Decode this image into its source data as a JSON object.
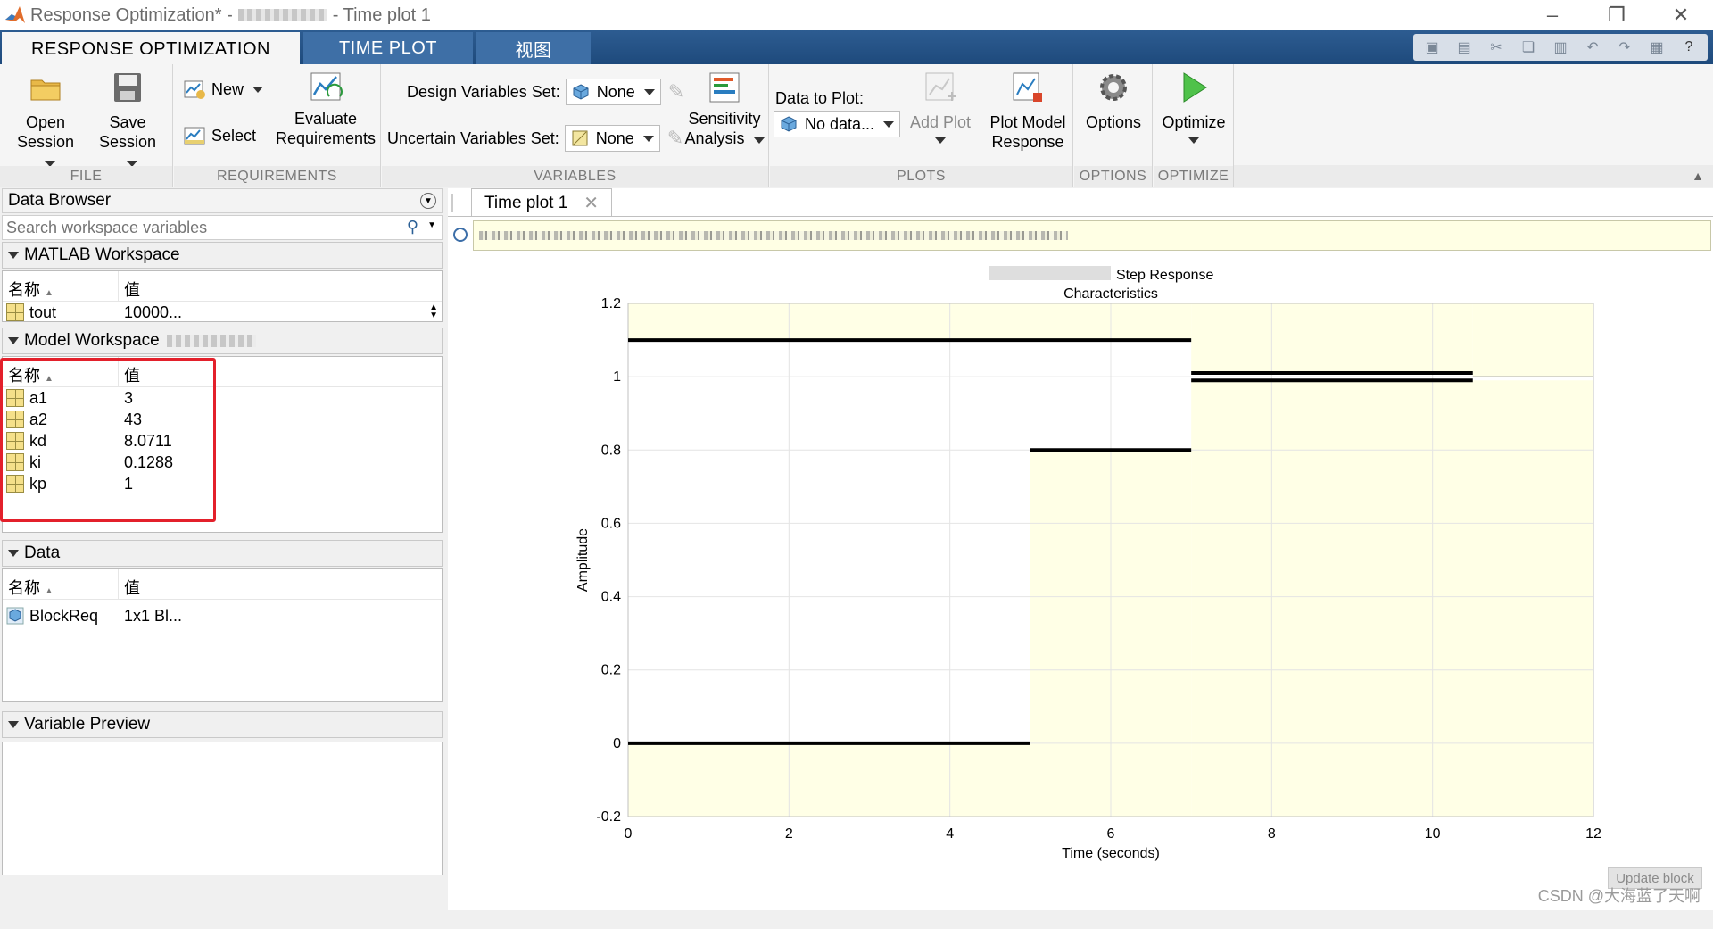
{
  "window": {
    "title_prefix": "Response Optimization* -",
    "title_suffix": "- Time plot 1"
  },
  "tabs": [
    {
      "label": "RESPONSE OPTIMIZATION"
    },
    {
      "label": "TIME PLOT"
    },
    {
      "label": "视图"
    }
  ],
  "toolstrip": {
    "file": {
      "label": "FILE",
      "open_line1": "Open",
      "open_line2": "Session",
      "save_line1": "Save",
      "save_line2": "Session"
    },
    "requirements": {
      "label": "REQUIREMENTS",
      "new": "New",
      "select": "Select",
      "evaluate_line1": "Evaluate",
      "evaluate_line2": "Requirements"
    },
    "variables": {
      "label": "VARIABLES",
      "design_label": "Design Variables Set:",
      "design_value": "None",
      "uncertain_label": "Uncertain Variables Set:",
      "uncertain_value": "None",
      "sensitivity_line1": "Sensitivity",
      "sensitivity_line2": "Analysis"
    },
    "plots": {
      "label": "PLOTS",
      "data_to_plot_label": "Data to Plot:",
      "data_to_plot_value": "No data...",
      "add_plot": "Add Plot",
      "plot_model_line1": "Plot Model",
      "plot_model_line2": "Response"
    },
    "options": {
      "label": "OPTIONS",
      "button": "Options"
    },
    "optimize": {
      "label": "OPTIMIZE",
      "button": "Optimize"
    }
  },
  "data_browser": {
    "title": "Data Browser",
    "search_placeholder": "Search workspace variables",
    "matlab_workspace": {
      "title": "MATLAB Workspace",
      "col_name": "名称",
      "col_value": "值",
      "rows": [
        {
          "name": "tout",
          "value": "10000..."
        }
      ]
    },
    "model_workspace": {
      "title": "Model Workspace",
      "col_name": "名称",
      "col_value": "值",
      "rows": [
        {
          "name": "a1",
          "value": "3"
        },
        {
          "name": "a2",
          "value": "43"
        },
        {
          "name": "kd",
          "value": "8.0711"
        },
        {
          "name": "ki",
          "value": "0.1288"
        },
        {
          "name": "kp",
          "value": "1"
        }
      ]
    },
    "data": {
      "title": "Data",
      "col_name": "名称",
      "col_value": "值",
      "rows": [
        {
          "name": "BlockReq",
          "value": "1x1 Bl..."
        }
      ]
    },
    "variable_preview": {
      "title": "Variable Preview"
    }
  },
  "document": {
    "tab_label": "Time plot 1",
    "update_block": "Update block"
  },
  "watermark": "CSDN @大海蓝了天啊",
  "chart_data": {
    "type": "line",
    "title_line1": "Step Response",
    "title_line2": "Characteristics",
    "xlabel": "Time (seconds)",
    "ylabel": "Amplitude",
    "xlim": [
      0,
      12
    ],
    "ylim": [
      -0.2,
      1.2
    ],
    "xticks": [
      "0",
      "2",
      "4",
      "6",
      "8",
      "10",
      "12"
    ],
    "yticks": [
      "-0.2",
      "0",
      "0.2",
      "0.4",
      "0.6",
      "0.8",
      "1",
      "1.2"
    ],
    "grid": true,
    "background_color": "#ffffe6",
    "shaded_regions": [
      {
        "x": [
          0,
          5
        ],
        "y": [
          -0.2,
          0
        ]
      },
      {
        "x": [
          5,
          7
        ],
        "y": [
          -0.2,
          0.8
        ]
      },
      {
        "x": [
          7,
          12
        ],
        "y": [
          -0.2,
          0.99
        ]
      },
      {
        "x": [
          0,
          7
        ],
        "y": [
          1.1,
          1.2
        ]
      },
      {
        "x": [
          7,
          10.5
        ],
        "y": [
          1.01,
          1.2
        ]
      },
      {
        "x": [
          10.5,
          12
        ],
        "y": [
          1.0,
          1.2
        ]
      }
    ],
    "bound_segments": [
      {
        "name": "upper",
        "x": [
          0,
          7
        ],
        "y": [
          1.1,
          1.1
        ]
      },
      {
        "name": "upper",
        "x": [
          7,
          10.5
        ],
        "y": [
          1.01,
          1.01
        ]
      },
      {
        "name": "lower",
        "x": [
          0,
          5
        ],
        "y": [
          0,
          0
        ]
      },
      {
        "name": "lower",
        "x": [
          5,
          7
        ],
        "y": [
          0.8,
          0.8
        ]
      },
      {
        "name": "lower",
        "x": [
          7,
          10.5
        ],
        "y": [
          0.99,
          0.99
        ]
      },
      {
        "name": "reference",
        "x": [
          10.5,
          12
        ],
        "y": [
          1.0,
          1.0
        ]
      }
    ]
  }
}
